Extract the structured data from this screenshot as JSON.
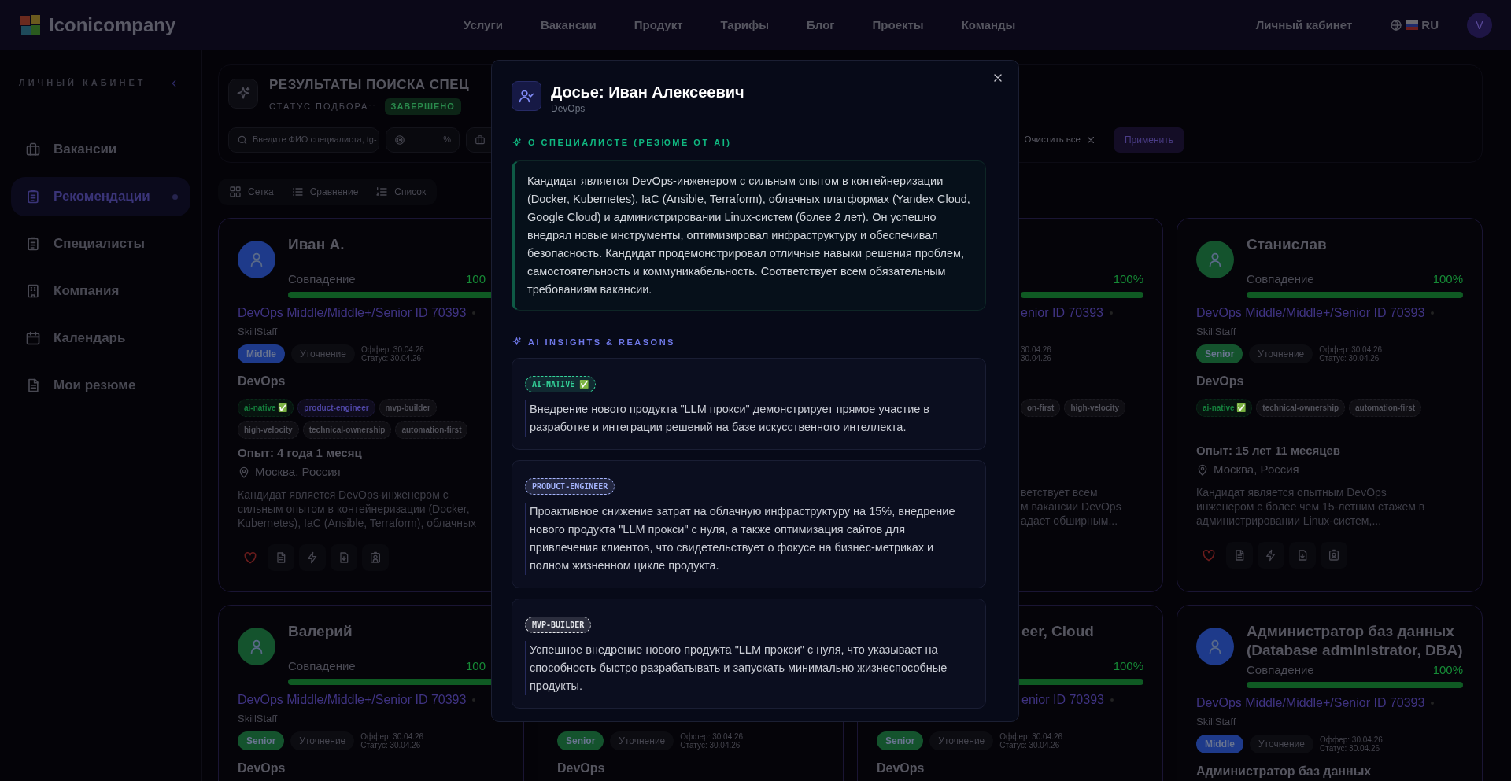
{
  "header": {
    "logo": "Iconicompany",
    "nav": [
      "Услуги",
      "Вакансии",
      "Продукт",
      "Тарифы",
      "Блог",
      "Проекты",
      "Команды"
    ],
    "account": "Личный кабинет",
    "language": "RU",
    "avatar": "V"
  },
  "sidebar": {
    "title": "ЛИЧНЫЙ КАБИНЕТ",
    "items": [
      {
        "label": "Вакансии",
        "selected": false
      },
      {
        "label": "Рекомендации",
        "selected": true
      },
      {
        "label": "Специалисты",
        "selected": false
      },
      {
        "label": "Компания",
        "selected": false
      },
      {
        "label": "Календарь",
        "selected": false
      },
      {
        "label": "Мои резюме",
        "selected": false
      }
    ]
  },
  "page": {
    "title": "РЕЗУЛЬТАТЫ ПОИСКА СПЕЦ",
    "status_label": "СТАТУС ПОДБОРА::",
    "status": "ЗАВЕРШЕНО"
  },
  "filters": {
    "search_placeholder": "Введите ФИО специалиста, tg-",
    "percent_unit": "%",
    "clear": "Очистить все",
    "apply": "Применить"
  },
  "views": [
    "Сетка",
    "Сравнение",
    "Список"
  ],
  "card_rows": [
    [
      {
        "kind": "full",
        "color": "#1e3a8a",
        "name": "Иван А.",
        "match_label": "Совпадение",
        "level": 1,
        "clipped": {
          "match_value": "100"
        },
        "job": "DevOps Middle/Middle+/Senior ID 70393",
        "company": "SkillStaff",
        "grade": {
          "label": "Middle",
          "color": "#1e3a8a"
        },
        "status": "Уточнение",
        "dates": [
          "Оффер: 30.04.26",
          "Статус: 30.04.26"
        ],
        "specialty": "DevOps",
        "tags": [
          {
            "label": "ai-native ✅",
            "color": "#15803d"
          },
          {
            "label": "product-engineer",
            "color": "#4f46a5"
          },
          {
            "label": "mvp-builder",
            "color": "#52525b"
          },
          {
            "label": "high-velocity",
            "color": "#52525b"
          },
          {
            "label": "technical-ownership",
            "color": "#52525b"
          },
          {
            "label": "automation-first",
            "color": "#52525b"
          }
        ],
        "experience": "Опыт: 4 года 1 месяц",
        "location": "Москва, Россия",
        "summary": "Кандидат является DevOps-инженером с сильным опытом в контейнеризации (Docker, Kubernetes), IaC (Ansible, Terraform), облачных"
      },
      {
        "kind": "partial",
        "match_value": "100%",
        "level": 1,
        "clipped": {
          "job": "enior ID 70393",
          "dates": [
            "30.04.26",
            "30.04.26"
          ],
          "tags": [
            {
              "label": "on-first",
              "color": "#52525b"
            },
            {
              "label": "high-velocity",
              "color": "#52525b"
            }
          ],
          "summary_lines": [
            "ветствует всем",
            "м вакансии DevOps",
            "адает обширным..."
          ]
        }
      },
      {
        "kind": "full",
        "color": "#14532d",
        "name": "Станислав",
        "match_label": "Совпадение",
        "match_value": "100%",
        "level": 1,
        "job": "DevOps Middle/Middle+/Senior ID 70393",
        "company": "SkillStaff",
        "grade": {
          "label": "Senior",
          "color": "#14532d"
        },
        "status": "Уточнение",
        "dates": [
          "Оффер: 30.04.26",
          "Статус: 30.04.26"
        ],
        "specialty": "DevOps",
        "tags": [
          {
            "label": "ai-native ✅",
            "color": "#15803d"
          },
          {
            "label": "technical-ownership",
            "color": "#52525b"
          },
          {
            "label": "automation-first",
            "color": "#52525b"
          }
        ],
        "experience": "Опыт: 15 лет 11 месяцев",
        "location": "Москва, Россия",
        "summary": "Кандидат является опытным DevOps инженером с более чем 15-летним стажем в администрировании Linux-систем,..."
      }
    ],
    [
      {
        "kind": "partial",
        "color": "#14532d",
        "name": "Валерий",
        "match_label": "Совпадение",
        "level": 1,
        "clipped": {
          "match_value": "100"
        },
        "job": "DevOps Middle/Middle+/Senior ID 70393",
        "company": "SkillStaff",
        "grade": {
          "label": "Senior",
          "color": "#14532d"
        },
        "status": "Уточнение",
        "dates": [
          "Оффер: 30.04.26",
          "Статус: 30.04.26"
        ],
        "specialty": "DevOps"
      },
      {
        "kind": "partial",
        "grade": {
          "label": "Senior",
          "color": "#14532d"
        },
        "status": "Уточнение",
        "dates": [
          "Оффер: 30.04.26",
          "Статус: 30.04.26"
        ],
        "specialty": "DevOps"
      },
      {
        "kind": "partial",
        "match_value": "100%",
        "level": 1,
        "clipped": {
          "title": "eer, Cloud",
          "job": "enior ID 70393"
        },
        "grade": {
          "label": "Senior",
          "color": "#14532d"
        },
        "status": "Уточнение",
        "dates": [
          "Оффер: 30.04.26",
          "Статус: 30.04.26"
        ],
        "specialty": "DevOps"
      },
      {
        "kind": "partial",
        "color": "#1e3a8a",
        "name": "Администратор баз данных (Database administrator, DBA)",
        "match_label": "Совпадение",
        "match_value": "100%",
        "level": 1,
        "job": "DevOps Middle/Middle+/Senior ID 70393",
        "company": "SkillStaff",
        "grade": {
          "label": "Middle",
          "color": "#1e3a8a"
        },
        "status": "Уточнение",
        "dates": [
          "Оффер: 30.04.26",
          "Статус: 30.04.26"
        ],
        "specialty": "Администратор баз данных"
      }
    ]
  ],
  "modal": {
    "title": "Досье: Иван Алексеевич",
    "subtitle": "DevOps",
    "summary_heading": "О СПЕЦИАЛИСТЕ (РЕЗЮМЕ ОТ AI)",
    "summary": "Кандидат является DevOps-инженером с сильным опытом в контейнеризации (Docker, Kubernetes), IaC (Ansible, Terraform), облачных платформах (Yandex Cloud, Google Cloud) и администрировании Linux-систем (более 2 лет). Он успешно внедрял новые инструменты, оптимизировал инфраструктуру и обеспечивал безопасность. Кандидат продемонстрировал отличные навыки решения проблем, самостоятельность и коммуникабельность. Соответствует всем обязательным требованиям вакансии.",
    "insights_heading": "AI INSIGHTS & REASONS",
    "insights": [
      {
        "tag": "AI-NATIVE ✅",
        "color": "#34d399",
        "text": "Внедрение нового продукта \"LLM прокси\" демонстрирует прямое участие в разработке и интеграции решений на базе искусственного интеллекта."
      },
      {
        "tag": "PRODUCT-ENGINEER",
        "color": "#a5b4fc",
        "text": "Проактивное снижение затрат на облачную инфраструктуру на 15%, внедрение нового продукта \"LLM прокси\" с нуля, а также оптимизация сайтов для привлечения клиентов, что свидетельствует о фокусе на бизнес-метриках и полном жизненном цикле продукта."
      },
      {
        "tag": "MVP-BUILDER",
        "color": "#e5e7eb",
        "text": "Успешное внедрение нового продукта \"LLM прокси\" с нуля, что указывает на способность быстро разрабатывать и запускать минимально жизнеспособные продукты."
      }
    ]
  }
}
